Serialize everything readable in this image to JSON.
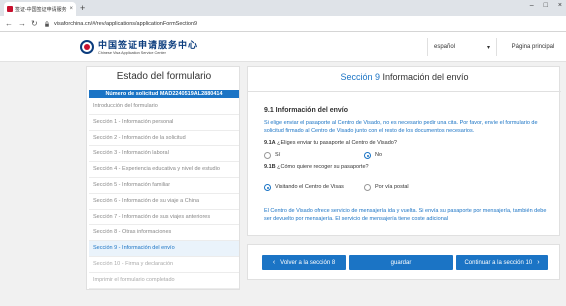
{
  "browser": {
    "tab_title": "签证-中国签证申请服务中心",
    "close_glyph": "×",
    "new_tab_glyph": "+",
    "url": "visaforchina.cn/#/rev/applications/applicationFormSection9",
    "icons": [
      "back-icon",
      "forward-icon",
      "reload-icon",
      "lock-icon"
    ]
  },
  "header": {
    "logo_cn": "中国签证申请服务中心",
    "logo_en": "Chinese Visa Application Service Center",
    "language": "español",
    "home_link": "Página principal"
  },
  "sidebar": {
    "title": "Estado del formulario",
    "application_number": "Número de solicitud MAD2240519AL2880414",
    "items": [
      {
        "label": "Introducción del formulario"
      },
      {
        "label": "Sección 1 - Información personal"
      },
      {
        "label": "Sección 2 - Información de la solicitud"
      },
      {
        "label": "Sección 3 - Información laboral"
      },
      {
        "label": "Sección 4 - Experiencia educativa y nivel de estudio"
      },
      {
        "label": "Sección 5 - Información familiar"
      },
      {
        "label": "Sección 6 - Información de su viaje a China"
      },
      {
        "label": "Sección 7 - Información de sus viajes anteriores"
      },
      {
        "label": "Sección 8 - Otras informaciones"
      },
      {
        "label": "Sección 9 - Información del envío"
      },
      {
        "label": "Sección 10 - Firma y declaración"
      },
      {
        "label": "Imprimir el formulario completado"
      }
    ],
    "active_index": 9
  },
  "main": {
    "title_number": "Sección 9",
    "title_text": "Información del envío",
    "heading": "9.1 Información del envío",
    "info": "Si elige enviar el pasaporte al Centro de Visado, no es necesario pedir una cita. Por favor, envíe el formulario de solicitud firmado al Centro de Visado junto con el resto de los documentos necesarios.",
    "q1_code": "9.1A",
    "q1_text": "¿Eliges enviar tu pasaporte al Centro de Visado?",
    "q1_options": [
      "Sí",
      "No"
    ],
    "q1_selected": "No",
    "q2_code": "9.1B",
    "q2_text": "¿Cómo quiere recoger su pasaporte?",
    "q2_options": [
      "Visitando el Centro de Visas",
      "Por vía postal"
    ],
    "q2_selected": "Visitando el Centro de Visas",
    "note": "El Centro de Visado ofrece servicio de mensajería ida y vuelta. Si envía su pasaporte por mensajería, también debe ser devuelto por mensajería. El servicio de mensajería tiene coste adicional"
  },
  "actions": {
    "back": "Volver a la sección 8",
    "save": "guardar",
    "next": "Continuar a la sección 10",
    "chevron_left": "‹",
    "chevron_right": "›"
  },
  "colors": {
    "accent": "#1b74c5",
    "brand_navy": "#0b3c7d",
    "brand_red": "#c8102e"
  }
}
